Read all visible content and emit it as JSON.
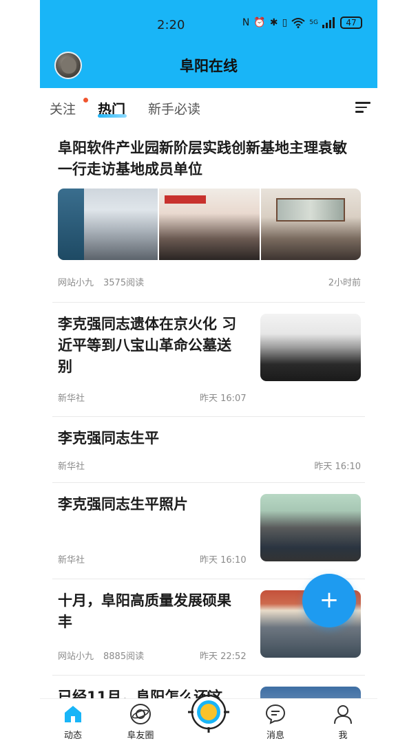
{
  "status": {
    "time": "2:20",
    "battery": "47",
    "network": "5G"
  },
  "header": {
    "title": "阜阳在线"
  },
  "tabs": [
    {
      "label": "关注"
    },
    {
      "label": "热门"
    },
    {
      "label": "新手必读"
    }
  ],
  "articles": [
    {
      "title": "阜阳软件产业园新阶层实践创新基地主理袁敏一行走访基地成员单位",
      "source": "网站小九",
      "reads": "3575阅读",
      "time": "2小时前"
    },
    {
      "title": "李克强同志遗体在京火化 习近平等到八宝山革命公墓送别",
      "source": "新华社",
      "time": "昨天 16:07"
    },
    {
      "title": "李克强同志生平",
      "source": "新华社",
      "time": "昨天 16:10"
    },
    {
      "title": "李克强同志生平照片",
      "source": "新华社",
      "time": "昨天 16:10"
    },
    {
      "title": "十月，阜阳高质量发展硕果丰",
      "source": "网站小九",
      "reads": "8885阅读",
      "time": "昨天 22:52"
    },
    {
      "title": "已经11月，阜阳怎么还这"
    }
  ],
  "fab": {
    "label": "+"
  },
  "bottom_nav": [
    {
      "label": "动态"
    },
    {
      "label": "阜友圈"
    },
    {
      "label": "消息"
    },
    {
      "label": "我"
    }
  ],
  "colors": {
    "brand": "#19b5f7",
    "accent": "#1e9bf0",
    "active_nav": "#19b5f7",
    "badge": "#f0552f"
  }
}
